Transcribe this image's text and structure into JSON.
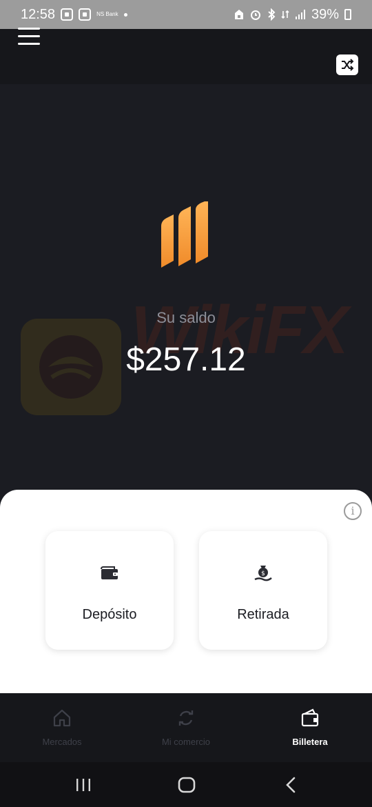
{
  "status_bar": {
    "time": "12:58",
    "mini_text": "NS Bank",
    "battery": "39%"
  },
  "header": {
    "menu_icon": "hamburger-menu-icon",
    "shuffle_icon": "shuffle-icon"
  },
  "balance": {
    "label": "Su saldo",
    "amount": "$257.12"
  },
  "watermark": {
    "text": "WikiFX"
  },
  "actions": {
    "deposit": {
      "label": "Depósito",
      "icon": "wallet-icon"
    },
    "withdraw": {
      "label": "Retirada",
      "icon": "money-bag-hand-icon"
    },
    "info_icon": "info-icon"
  },
  "tabs": [
    {
      "label": "Mercados",
      "icon": "home-icon",
      "active": false
    },
    {
      "label": "Mi comercio",
      "icon": "refresh-icon",
      "active": false
    },
    {
      "label": "Billetera",
      "icon": "wallet-icon",
      "active": true
    }
  ],
  "colors": {
    "background": "#1b1c22",
    "accent": "#f7a53a",
    "sheet": "#ffffff"
  }
}
